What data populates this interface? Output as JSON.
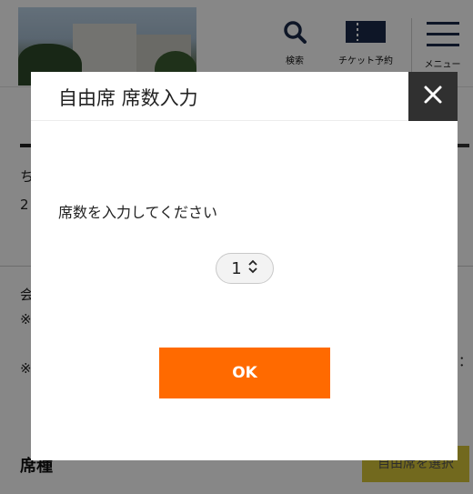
{
  "header": {
    "search_label": "検索",
    "ticket_label": "チケット予約",
    "menu_label": "メニュー"
  },
  "background": {
    "line_a": "ち",
    "line_b": "2",
    "line_c": "会",
    "line_d": "※",
    "line_e": "※",
    "line_f": "：",
    "seat_type_title": "席種",
    "select_free_seat": "自由席を選択"
  },
  "modal": {
    "title": "自由席 席数入力",
    "prompt": "席数を入力してください",
    "seat_count": "1",
    "ok_label": "OK"
  },
  "colors": {
    "accent": "#ff6a00",
    "close_bg": "#303030"
  }
}
